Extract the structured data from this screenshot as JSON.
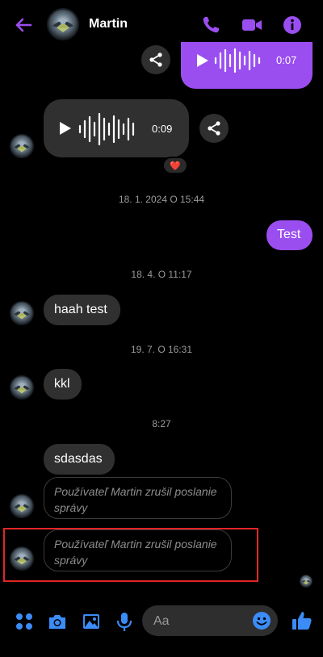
{
  "colors": {
    "accent": "#9b4ef0",
    "icon_blue": "#3b8cf7",
    "bubble_other": "#303030",
    "highlight": "#e32626"
  },
  "header": {
    "contact_name": "Martin",
    "icons": [
      "back-arrow-icon",
      "avatar",
      "phone-icon",
      "video-camera-icon",
      "info-icon"
    ]
  },
  "messages": {
    "voice_sent": {
      "duration": "0:07"
    },
    "voice_received": {
      "duration": "0:09",
      "reaction": "❤️"
    },
    "ts1": "18. 1. 2024 O 15:44",
    "test": "Test",
    "ts2": "18. 4. O 11:17",
    "haah": "haah test",
    "ts3": "19. 7. O 16:31",
    "kkl": "kkl",
    "ts4": "8:27",
    "sdasdas": "sdasdas",
    "unsent1": "Používateľ Martin zrušil poslanie správy",
    "unsent2": "Používateľ Martin zrušil poslanie správy"
  },
  "composer": {
    "placeholder": "Aa",
    "icons": [
      "menu-dots-icon",
      "camera-icon",
      "gallery-icon",
      "microphone-icon",
      "emoji-icon",
      "thumbs-up-icon"
    ]
  }
}
